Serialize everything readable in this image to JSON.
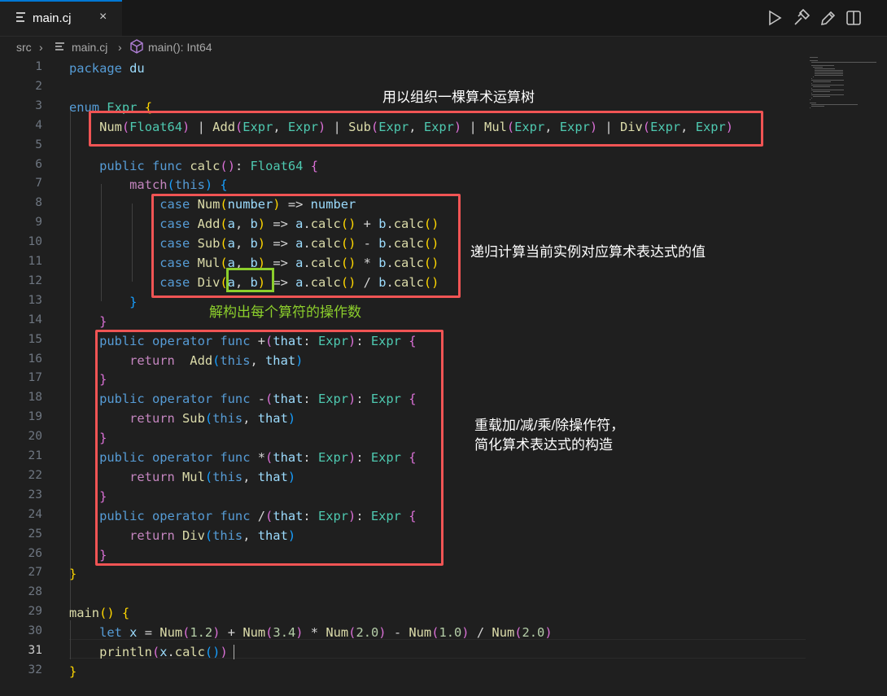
{
  "tab": {
    "label": "main.cj",
    "close": "×",
    "file_icon": "lines-file-icon"
  },
  "editor_actions": [
    "run-icon",
    "build-icon",
    "edit-icon",
    "split-editor-icon"
  ],
  "breadcrumb": {
    "folder": "src",
    "file": "main.cj",
    "symbol": "main(): Int64"
  },
  "line_numbers": [
    "1",
    "2",
    "3",
    "4",
    "5",
    "6",
    "7",
    "8",
    "9",
    "10",
    "11",
    "12",
    "13",
    "14",
    "15",
    "16",
    "17",
    "18",
    "19",
    "20",
    "21",
    "22",
    "23",
    "24",
    "25",
    "26",
    "27",
    "28",
    "29",
    "30",
    "31",
    "32"
  ],
  "current_line": "31",
  "code_lines": [
    "package du",
    "",
    "enum Expr {",
    "    Num(Float64) | Add(Expr, Expr) | Sub(Expr, Expr) | Mul(Expr, Expr) | Div(Expr, Expr)",
    "",
    "    public func calc(): Float64 {",
    "        match(this) {",
    "            case Num(number) => number",
    "            case Add(a, b) => a.calc() + b.calc()",
    "            case Sub(a, b) => a.calc() - b.calc()",
    "            case Mul(a, b) => a.calc() * b.calc()",
    "            case Div(a, b) => a.calc() / b.calc()",
    "        }",
    "    }",
    "    public operator func +(that: Expr): Expr {",
    "        return  Add(this, that)",
    "    }",
    "    public operator func -(that: Expr): Expr {",
    "        return Sub(this, that)",
    "    }",
    "    public operator func *(that: Expr): Expr {",
    "        return Mul(this, that)",
    "    }",
    "    public operator func /(that: Expr): Expr {",
    "        return Div(this, that)",
    "    }",
    "}",
    "",
    "main() {",
    "    let x = Num(1.2) + Num(3.4) * Num(2.0) - Num(1.0) / Num(2.0)",
    "    println(x.calc())",
    "}"
  ],
  "annotations": {
    "enum_tree": "用以组织一棵算术运算树",
    "recursive_calc": "递归计算当前实例对应算术表达式的值",
    "destructure": "解构出每个算符的操作数",
    "operators_line1": "重载加/减/乘/除操作符，",
    "operators_line2": "简化算术表达式的构造"
  },
  "colors": {
    "annotation_box": "#f05454",
    "destructure_box": "#8ccf2c",
    "keyword": "#569cd6",
    "type": "#4ec9b0",
    "function": "#dcdcaa",
    "variable": "#9cdcfe",
    "number": "#b5cea8"
  }
}
